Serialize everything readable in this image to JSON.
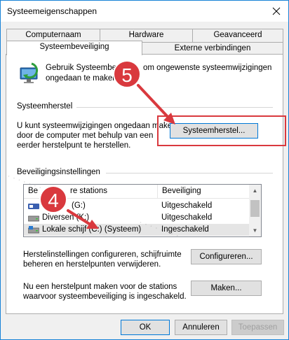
{
  "window": {
    "title": "Systeemeigenschappen"
  },
  "tabs": {
    "top_row": [
      "Computernaam",
      "Hardware",
      "Geavanceerd"
    ],
    "bottom_row": [
      "Systeembeveiliging",
      "Externe verbindingen"
    ]
  },
  "intro": {
    "line1_a": "Gebruik Systeembe",
    "line1_b": "om ongewenste systeemwijzigingen",
    "line2": "ongedaan te maken."
  },
  "restore": {
    "section_title": "Systeemherstel",
    "description": [
      "U kunt systeemwijzigingen ongedaan maken",
      "door de computer met behulp van een",
      "eerder herstelpunt te herstellen."
    ],
    "button": "Systeemherstel..."
  },
  "protection": {
    "section_title": "Beveiligingsinstellingen",
    "columns": [
      "Be",
      "re stations",
      "Beveiliging"
    ],
    "drives": [
      {
        "name": "(G:)",
        "status": "Uitgeschakeld",
        "selected": false
      },
      {
        "name": "Diversen (K:)",
        "status": "Uitgeschakeld",
        "selected": false
      },
      {
        "name": "Lokale schijf (C:) (Systeem)",
        "status": "Ingeschakeld",
        "selected": true
      }
    ]
  },
  "configure": {
    "description": [
      "Herstelinstellingen configureren, schijfruimte",
      "beheren en herstelpunten verwijderen."
    ],
    "button": "Configureren..."
  },
  "create": {
    "description": [
      "Nu een herstelpunt maken voor de stations",
      "waarvoor systeembeveiliging is ingeschakeld."
    ],
    "button": "Maken..."
  },
  "footer": {
    "ok": "OK",
    "cancel": "Annuleren",
    "apply": "Toepassen"
  },
  "callouts": {
    "step_a": "5",
    "step_b": "4"
  },
  "colors": {
    "callout": "#d9393e",
    "accent": "#0078d7",
    "window_border": "#1883d7"
  }
}
